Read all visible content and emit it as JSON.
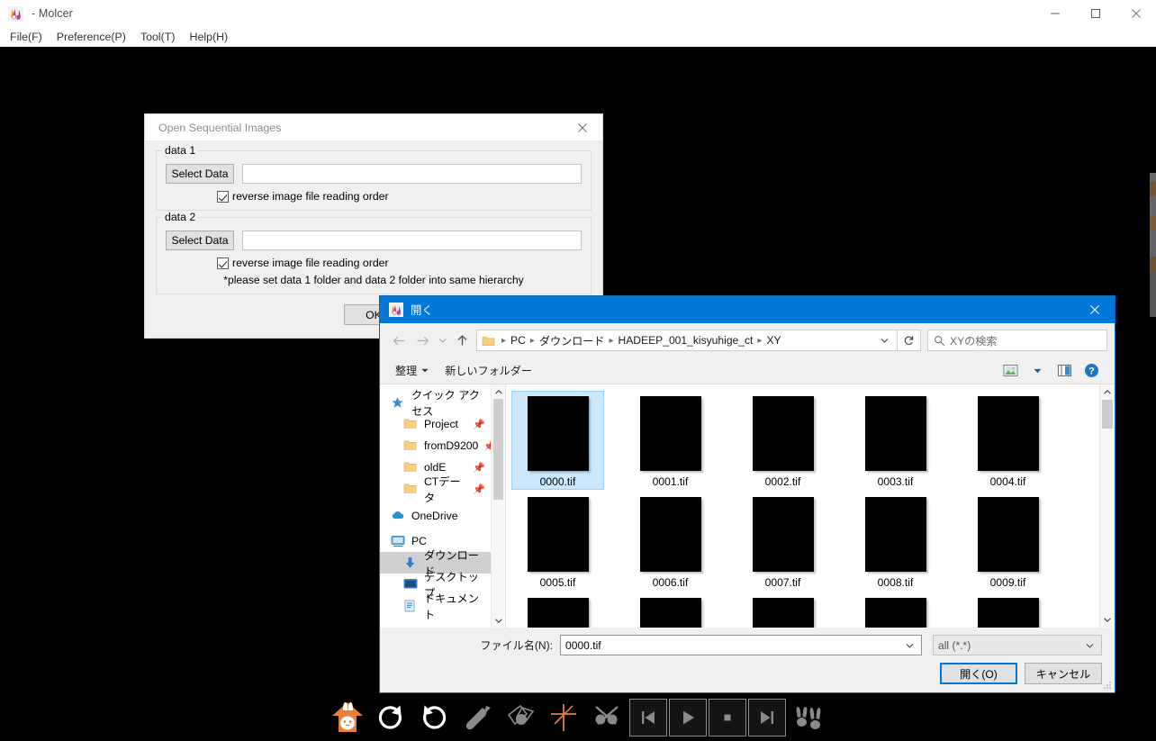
{
  "main_window": {
    "title": "- Molcer",
    "app_icon": "molcer-rabbit-icon",
    "menus": [
      {
        "label": "File(F)",
        "name": "file"
      },
      {
        "label": "Preference(P)",
        "name": "preference"
      },
      {
        "label": "Tool(T)",
        "name": "tool"
      },
      {
        "label": "Help(H)",
        "name": "help"
      }
    ],
    "window_controls": {
      "minimize": "minimize-icon",
      "maximize": "maximize-icon",
      "close": "close-icon"
    }
  },
  "sequential_dialog": {
    "title": "Open Sequential Images",
    "close_icon": "close-icon",
    "group1": {
      "label": "data 1",
      "select_button": "Select Data",
      "path_value": "",
      "path_placeholder": "",
      "checkbox_label": "reverse image file reading order",
      "checked": true
    },
    "group2": {
      "label": "data 2",
      "select_button": "Select Data",
      "path_value": "",
      "path_placeholder": "",
      "checkbox_label": "reverse image file reading order",
      "checked": true
    },
    "note": "*please set data 1 folder and data 2 folder into same hierarchy",
    "ok_button": "OK"
  },
  "open_dialog": {
    "title": "開く",
    "icon": "molcer-rabbit-icon",
    "close_icon": "close-icon",
    "nav": {
      "back_icon": "arrow-left-icon",
      "forward_icon": "arrow-right-icon",
      "recent_icon": "chevron-down-icon",
      "up_icon": "arrow-up-icon",
      "refresh_icon": "refresh-icon",
      "breadcrumb_folder_icon": "folder-icon",
      "breadcrumb": [
        "PC",
        "ダウンロード",
        "HADEEP_001_kisyuhige_ct",
        "XY"
      ],
      "breadcrumb_caret": "chevron-down-icon",
      "search_icon": "search-icon",
      "search_placeholder": "XYの検索",
      "search_value": ""
    },
    "commandbar": {
      "organize": "整理",
      "organize_caret": "chevron-down-icon",
      "new_folder": "新しいフォルダー",
      "view_icon": "view-layout-icon",
      "view_caret": "chevron-down-icon",
      "preview_pane_icon": "preview-pane-icon",
      "help_icon": "help-icon"
    },
    "sidebar": {
      "scroll_up_icon": "chevron-up-icon",
      "scroll_down_icon": "chevron-down-icon",
      "items": [
        {
          "label": "クイック アクセス",
          "icon": "star-icon",
          "indent": 0,
          "pinned": false,
          "selected": false
        },
        {
          "label": "Project",
          "icon": "folder-icon",
          "indent": 1,
          "pinned": true,
          "selected": false
        },
        {
          "label": "fromD9200",
          "icon": "folder-icon",
          "indent": 1,
          "pinned": true,
          "selected": false
        },
        {
          "label": "oldE",
          "icon": "folder-icon",
          "indent": 1,
          "pinned": true,
          "selected": false
        },
        {
          "label": "CTデータ",
          "icon": "folder-icon",
          "indent": 1,
          "pinned": true,
          "selected": false
        },
        {
          "label": "OneDrive",
          "icon": "cloud-icon",
          "indent": 0,
          "pinned": false,
          "selected": false
        },
        {
          "label": "PC",
          "icon": "monitor-icon",
          "indent": 0,
          "pinned": false,
          "selected": false
        },
        {
          "label": "ダウンロード",
          "icon": "download-icon",
          "indent": 1,
          "pinned": false,
          "selected": true
        },
        {
          "label": "デスクトップ",
          "icon": "desktop-icon",
          "indent": 1,
          "pinned": false,
          "selected": false
        },
        {
          "label": "ドキュメント",
          "icon": "document-icon",
          "indent": 1,
          "pinned": false,
          "selected": false
        }
      ]
    },
    "files": [
      {
        "name": "0000.tif",
        "selected": true
      },
      {
        "name": "0001.tif",
        "selected": false
      },
      {
        "name": "0002.tif",
        "selected": false
      },
      {
        "name": "0003.tif",
        "selected": false
      },
      {
        "name": "0004.tif",
        "selected": false
      },
      {
        "name": "0005.tif",
        "selected": false
      },
      {
        "name": "0006.tif",
        "selected": false
      },
      {
        "name": "0007.tif",
        "selected": false
      },
      {
        "name": "0008.tif",
        "selected": false
      },
      {
        "name": "0009.tif",
        "selected": false
      },
      {
        "name": "",
        "selected": false
      },
      {
        "name": "",
        "selected": false
      },
      {
        "name": "",
        "selected": false
      },
      {
        "name": "",
        "selected": false
      },
      {
        "name": "",
        "selected": false
      }
    ],
    "grid_scroll": {
      "up_icon": "chevron-up-icon",
      "down_icon": "chevron-down-icon"
    },
    "footer": {
      "filename_label": "ファイル名(N):",
      "filename_value": "0000.tif",
      "filename_caret": "chevron-down-icon",
      "filetype_value": "all (*.*)",
      "filetype_caret": "chevron-down-icon",
      "open_button": "開く(O)",
      "cancel_button": "キャンセル",
      "resize_grip": "resize-grip-icon"
    }
  },
  "bottom_toolbar": {
    "buttons": [
      {
        "name": "home-rabbit-icon",
        "framed": false
      },
      {
        "name": "rotate-cw-icon",
        "framed": false
      },
      {
        "name": "rotate-ccw-icon",
        "framed": false
      },
      {
        "name": "probe-icon",
        "framed": false
      },
      {
        "name": "clip-plane-icon",
        "framed": false
      },
      {
        "name": "axis-cross-icon",
        "framed": false
      },
      {
        "name": "scissors-icon",
        "framed": false
      },
      {
        "name": "skip-first-icon",
        "framed": true
      },
      {
        "name": "play-icon",
        "framed": true
      },
      {
        "name": "stop-icon",
        "framed": true
      },
      {
        "name": "skip-last-icon",
        "framed": true
      },
      {
        "name": "two-rabbits-icon",
        "framed": false
      }
    ],
    "accent_color": "#e8803a"
  }
}
